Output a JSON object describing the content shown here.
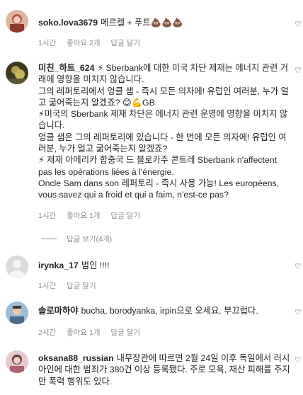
{
  "comments": [
    {
      "username": "soko.lova3679",
      "text": "메르켈 + 푸트💩💩💩",
      "time": "1시간",
      "likes": "좋아요 2개",
      "reply": "답글 달기",
      "avatar_color": "#c04a3a"
    },
    {
      "username": "미친_하트_624",
      "text": "⚡ Sberbank에 대한 미국 차단 제재는 에너지 관련 거래에 영향을 미치지 않습니다.\n그의 레퍼토리에서 엉클 샘 - 즉시 모든 의자에! 유럽인 여러분, 누가 얼고 굶어죽는지 알겠죠? 😊💪GB\n⚡미국의 Sberbank 제재 차단은 에너지 관련 운영에 영향을 미치지 않습니다.\n엉클 샘은 그의 레퍼토리에 있습니다 - 한 번에 모든 의자에! 유럽인 여러분, 누가 얼고 굶어죽는지 알겠죠?\n⚡ 제재 아메리카 합중국 드 블로카주 콘트레 Sberbank n'affectent pas les opérations liées à l'énergie.\nOncle Sam dans son 레퍼토리 - 즉시 사용 가능! Les européens, vous savez qui a froid et qui a faim, n'est-ce pas?",
      "time": "1시간",
      "likes": "좋아요 1개",
      "reply": "답글 달기",
      "view_replies": "답글 보기(4개)",
      "avatar_color": "#7a6a2a"
    },
    {
      "username": "irynka_17",
      "text": "범인 !!!!",
      "time": "1시간",
      "reply": "답글 달기",
      "avatar_color": "#d8d8d8"
    },
    {
      "username": "솔로마하야",
      "text": "bucha, borodyanka, irpin으로 오세요. 부끄럽다.",
      "time": "2시간",
      "likes": "좋아요 1개",
      "reply": "답글 달기",
      "avatar_color": "#6a8fb0"
    },
    {
      "username": "oksana88_russian",
      "text": "내무장관에 따르면 2월 24일 이후 독일에서 러시아인에 대한 범죄가 380건 이상 등록됐다. 주로 모욕, 재산 피해를 주지만 폭력 행위도 있다.",
      "avatar_color": "#c98fa0"
    }
  ],
  "icons": {
    "like": "heart-icon"
  }
}
